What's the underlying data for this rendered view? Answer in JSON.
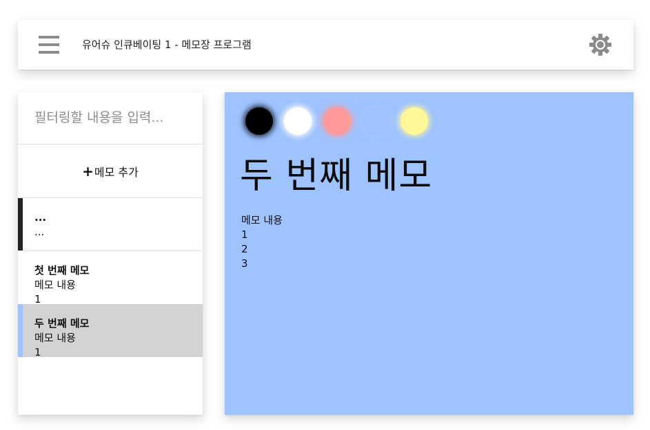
{
  "header": {
    "title": "유어슈 인큐베이팅 1 - 메모장 프로그램",
    "menu_icon": "hamburger-menu-icon",
    "settings_icon": "gear-icon"
  },
  "sidebar": {
    "filter": {
      "value": "",
      "placeholder": "필터링할 내용을 입력..."
    },
    "add_button": {
      "icon": "plus-icon",
      "plus": "+",
      "label": "메모 추가"
    },
    "memos": [
      {
        "title": "...",
        "body": "...",
        "color": "#222222",
        "selected": false
      },
      {
        "title": "첫 번째 메모",
        "body": "메모 내용\n1",
        "color": "#ffffff",
        "selected": false
      },
      {
        "title": "두 번째 메모",
        "body": "메모 내용\n1",
        "color": "#9ec3ff",
        "selected": true
      }
    ]
  },
  "editor": {
    "background": "#9ec3ff",
    "color_swatches": [
      {
        "name": "black",
        "color": "#000000"
      },
      {
        "name": "white",
        "color": "#ffffff"
      },
      {
        "name": "red",
        "color": "#ff9a9a"
      },
      {
        "name": "blue",
        "color": "#9ec3ff"
      },
      {
        "name": "yellow",
        "color": "#fff79a"
      }
    ],
    "title": "두 번째 메모",
    "body": "메모 내용\n1\n2\n3"
  }
}
